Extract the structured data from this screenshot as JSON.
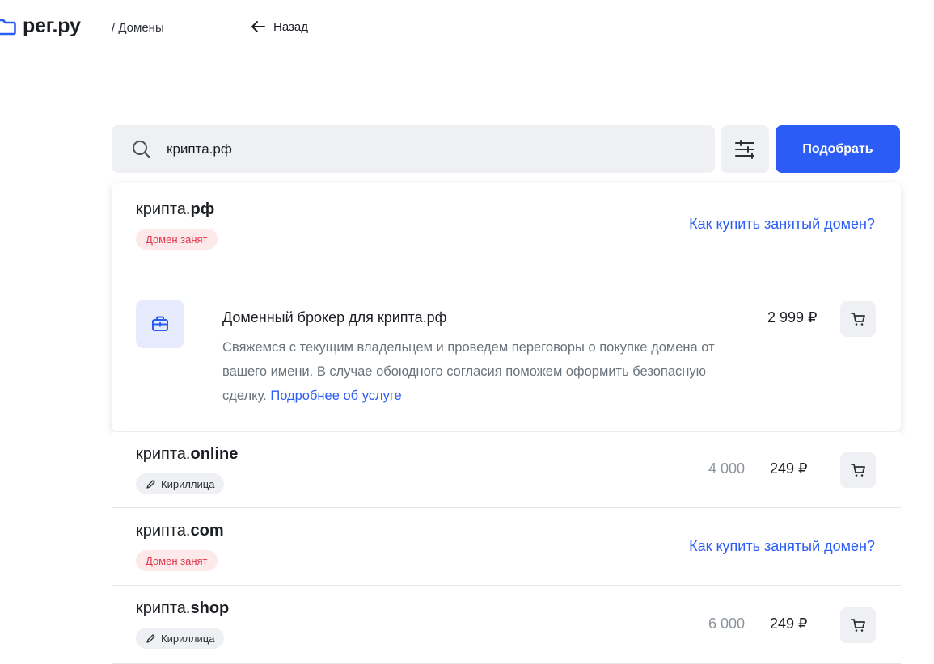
{
  "header": {
    "logo_text": "рег.ру",
    "breadcrumb": "/ Домены",
    "back_label": "Назад"
  },
  "search": {
    "value": "крипта.рф",
    "pick_button": "Подобрать"
  },
  "results": [
    {
      "name": "крипта.",
      "zone": "рф",
      "badge": "Домен занят",
      "link": "Как купить занятый домен?"
    },
    {
      "broker_title": "Доменный брокер для крипта.рф",
      "broker_desc": "Свяжемся с текущим владельцем и проведем переговоры о покупке домена от вашего имени. В случае обоюдного согласия поможем оформить безопасную сделку.",
      "broker_link": "Подробнее об услуге",
      "price": "2 999 ₽"
    },
    {
      "name": "крипта.",
      "zone": "online",
      "badge": "Кириллица",
      "old_price": "4 000",
      "price": "249 ₽"
    },
    {
      "name": "крипта.",
      "zone": "com",
      "badge": "Домен занят",
      "link": "Как купить занятый домен?"
    },
    {
      "name": "крипта.",
      "zone": "shop",
      "badge": "Кириллица",
      "old_price": "6 000",
      "price": "249 ₽"
    }
  ],
  "colors": {
    "accent": "#2c5cf6",
    "taken_bg": "#fde8ea",
    "taken_text": "#e0374a"
  }
}
